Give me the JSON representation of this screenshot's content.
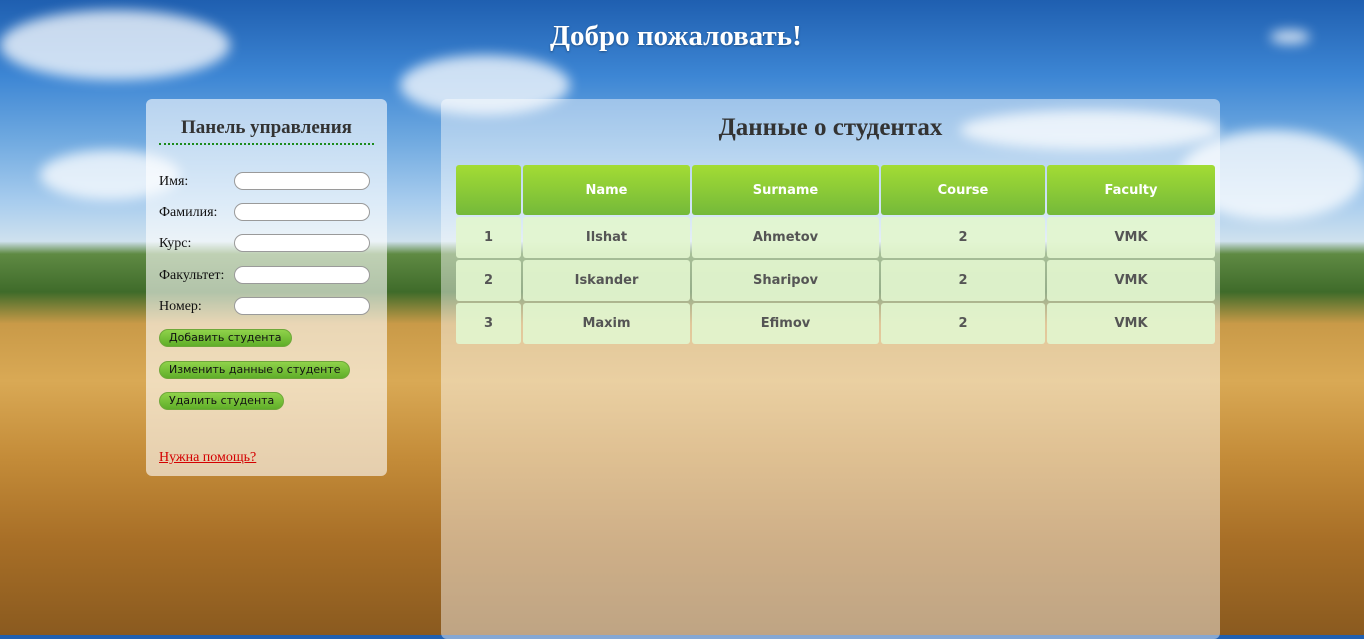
{
  "page": {
    "title": "Добро пожаловать!"
  },
  "panel": {
    "title": "Панель управления",
    "fields": [
      {
        "label": "Имя:",
        "value": "",
        "placeholder": ""
      },
      {
        "label": "Фамилия:",
        "value": "",
        "placeholder": ""
      },
      {
        "label": "Курс:",
        "value": "",
        "placeholder": ""
      },
      {
        "label": "Факультет:",
        "value": "",
        "placeholder": ""
      },
      {
        "label": "Номер:",
        "value": "",
        "placeholder": ""
      }
    ],
    "buttons": {
      "add": "Добавить студента",
      "edit": "Изменить данные о студенте",
      "delete": "Удалить студента"
    },
    "help_link": "Нужна помощь?"
  },
  "main": {
    "title": "Данные о студентах",
    "table": {
      "headers": [
        "",
        "Name",
        "Surname",
        "Course",
        "Faculty"
      ],
      "rows": [
        [
          "1",
          "Ilshat",
          "Ahmetov",
          "2",
          "VMK"
        ],
        [
          "2",
          "Iskander",
          "Sharipov",
          "2",
          "VMK"
        ],
        [
          "3",
          "Maxim",
          "Efimov",
          "2",
          "VMK"
        ]
      ]
    }
  },
  "colors": {
    "header_green": "#8fcf3c",
    "link_red": "#d40000",
    "accent_green": "#6fb83a"
  }
}
